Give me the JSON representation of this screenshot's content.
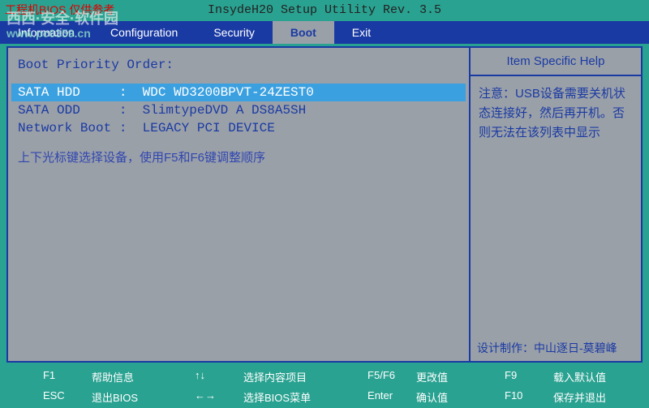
{
  "annotation": "工程机BIOS    仅供参考",
  "watermark_line1": "西西·安全·软件园",
  "watermark_url": "www.pc0359.cn",
  "title": "InsydeH20 Setup Utility Rev. 3.5",
  "menu": {
    "items": [
      {
        "label": "Information",
        "active": false
      },
      {
        "label": "Configuration",
        "active": false
      },
      {
        "label": "Security",
        "active": false
      },
      {
        "label": "Boot",
        "active": true
      },
      {
        "label": "Exit",
        "active": false
      }
    ]
  },
  "main": {
    "section_title": "Boot Priority Order:",
    "rows": [
      {
        "device": "SATA HDD",
        "value": "WDC WD3200BPVT-24ZEST0",
        "selected": true
      },
      {
        "device": "SATA ODD",
        "value": "SlimtypeDVD A DS8A5SH",
        "selected": false
      },
      {
        "device": "Network Boot",
        "value": "LEGACY PCI DEVICE",
        "selected": false
      }
    ],
    "hint": "上下光标键选择设备，使用F5和F6键调整顺序"
  },
  "help": {
    "title": "Item Specific Help",
    "body": "注意：USB设备需要关机状态连接好，然后再开机。否则无法在该列表中显示",
    "credit": "设计制作：中山逐日-莫碧峰"
  },
  "legend": {
    "cols": [
      [
        {
          "key": "F1",
          "label": "帮助信息"
        },
        {
          "key": "ESC",
          "label": "退出BIOS"
        }
      ],
      [
        {
          "key": "↑↓",
          "label": "选择内容项目"
        },
        {
          "key": "←→",
          "label": "选择BIOS菜单"
        }
      ],
      [
        {
          "key": "F5/F6",
          "label": "更改值"
        },
        {
          "key": "Enter",
          "label": "确认值"
        }
      ],
      [
        {
          "key": "F9",
          "label": "载入默认值"
        },
        {
          "key": "F10",
          "label": "保存并退出"
        }
      ]
    ]
  }
}
